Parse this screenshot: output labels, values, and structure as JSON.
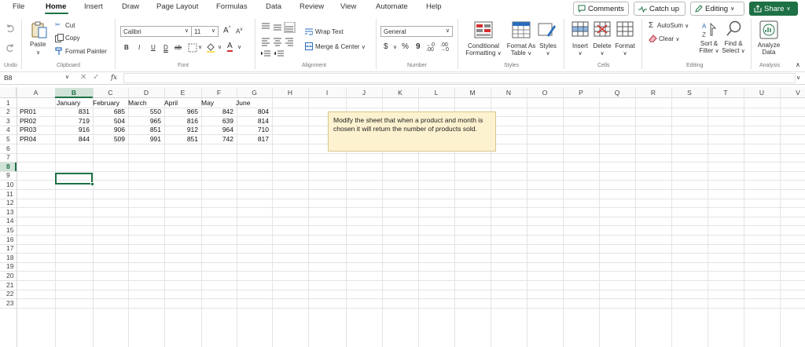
{
  "menu": {
    "tabs": [
      "File",
      "Home",
      "Insert",
      "Draw",
      "Page Layout",
      "Formulas",
      "Data",
      "Review",
      "View",
      "Automate",
      "Help"
    ],
    "comments": "Comments",
    "catch_up": "Catch up",
    "editing": "Editing",
    "share": "Share"
  },
  "ribbon": {
    "undo_group": "Undo",
    "paste": "Paste",
    "cut": "Cut",
    "copy": "Copy",
    "format_painter": "Format Painter",
    "clipboard": "Clipboard",
    "font_name": "Calibri",
    "font_size": "11",
    "bold": "B",
    "italic": "I",
    "underline": "U",
    "font_group": "Font",
    "wrap_text": "Wrap Text",
    "merge_center": "Merge & Center",
    "alignment": "Alignment",
    "number_format": "General",
    "dollar": "$",
    "percent": "%",
    "comma": "9",
    "number_group": "Number",
    "conditional_formatting_1": "Conditional",
    "conditional_formatting_2": "Formatting",
    "format_as_table_1": "Format As",
    "format_as_table_2": "Table",
    "styles_btn": "Styles",
    "styles_group": "Styles",
    "insert": "Insert",
    "delete": "Delete",
    "format": "Format",
    "cells_group": "Cells",
    "autosum": "AutoSum",
    "clear": "Clear",
    "sort_filter_1": "Sort &",
    "sort_filter_2": "Filter",
    "find_select_1": "Find &",
    "find_select_2": "Select",
    "editing_group": "Editing",
    "analyze_1": "Analyze",
    "analyze_2": "Data",
    "analysis_group": "Analysis"
  },
  "formula_bar": {
    "name_box": "B8",
    "fx": "fx",
    "content": ""
  },
  "grid": {
    "columns": [
      "A",
      "B",
      "C",
      "D",
      "E",
      "F",
      "G",
      "H",
      "I",
      "J",
      "K",
      "L",
      "M",
      "N",
      "O",
      "P",
      "Q",
      "R",
      "S",
      "T",
      "U",
      "V"
    ],
    "rows": [
      "1",
      "2",
      "3",
      "4",
      "5",
      "6",
      "7",
      "8",
      "9",
      "10",
      "11",
      "12",
      "13",
      "14",
      "15",
      "16",
      "17",
      "18",
      "19",
      "20",
      "21",
      "22",
      "23"
    ],
    "months": [
      "January",
      "February",
      "March",
      "April",
      "May",
      "June"
    ],
    "products": [
      "PR01",
      "PR02",
      "PR03",
      "PR04"
    ],
    "values": [
      [
        "831",
        "685",
        "550",
        "965",
        "842",
        "804"
      ],
      [
        "719",
        "504",
        "965",
        "816",
        "639",
        "814"
      ],
      [
        "916",
        "906",
        "851",
        "912",
        "964",
        "710"
      ],
      [
        "844",
        "509",
        "991",
        "851",
        "742",
        "817"
      ]
    ],
    "note": "Modify the sheet that when a product and month is chosen it will return the number of products sold."
  },
  "colors": {
    "accent": "#1e7145",
    "note_bg": "#fdf2d0",
    "note_border": "#d8c58a"
  }
}
